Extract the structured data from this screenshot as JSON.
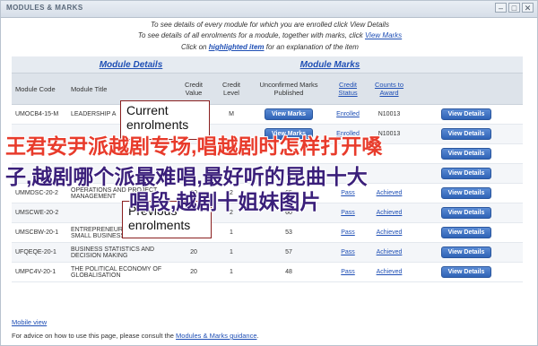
{
  "window": {
    "title": "MODULES & MARKS",
    "controls": [
      "–",
      "□",
      "✕"
    ]
  },
  "instructions": {
    "line1": "To see details of every module for which you are enrolled click View Details",
    "line2_prefix": "To see details of all enrolments for a module, together with marks, click",
    "line2_link": "View Marks",
    "line3_prefix": "Click on",
    "line3_link": "highlighted item",
    "line3_suffix": "for an explanation of the item"
  },
  "groups": {
    "module_details": "Module Details",
    "module_marks": "Module Marks"
  },
  "columns": {
    "module_code": "Module Code",
    "module_title": "Module Title",
    "credit_value": "Credit Value",
    "credit_level": "Credit Level",
    "unconfirmed_marks": "Unconfirmed Marks Published",
    "credit_status": "Credit Status",
    "counts_to_award": "Counts to Award"
  },
  "rows": [
    {
      "code": "UMOCB4-15-M",
      "title": "LEADERSHIP A",
      "value": "15",
      "level": "M",
      "action": "View Marks",
      "status": "Enrolled",
      "award": "N10013",
      "details": "View Details"
    },
    {
      "code": "",
      "title": "",
      "value": "",
      "level": "",
      "action": "View Marks",
      "status": "Enrolled",
      "award": "N10013",
      "details": "View Details"
    },
    {
      "code": "",
      "title": "",
      "value": "",
      "level": "",
      "action": "",
      "status": "",
      "award": "",
      "details": "View Details"
    },
    {
      "code": "",
      "title": "",
      "value": "",
      "level": "",
      "action": "",
      "status": "",
      "award": "",
      "details": "View Details"
    },
    {
      "code": "UMMDSC-20-2",
      "title": "OPERATIONS AND PROJECT MANAGEMENT",
      "value": "20",
      "level": "2",
      "action": "65",
      "status": "Pass",
      "award": "Achieved",
      "details": "View Details"
    },
    {
      "code": "UMSCWE-20-2",
      "title": "",
      "value": "20",
      "level": "2",
      "action": "60",
      "status": "Pass",
      "award": "Achieved",
      "details": "View Details"
    },
    {
      "code": "UMSCBW-20-1",
      "title": "ENTREPRENEURSHIP AND SMALL BUSINESS",
      "value": "20",
      "level": "1",
      "action": "53",
      "status": "Pass",
      "award": "Achieved",
      "details": "View Details"
    },
    {
      "code": "UFQEQE-20-1",
      "title": "BUSINESS STATISTICS AND DECISION MAKING",
      "value": "20",
      "level": "1",
      "action": "57",
      "status": "Pass",
      "award": "Achieved",
      "details": "View Details"
    },
    {
      "code": "UMPC4V-20-1",
      "title": "THE POLITICAL ECONOMY OF GLOBALISATION",
      "value": "20",
      "level": "1",
      "action": "48",
      "status": "Pass",
      "award": "Achieved",
      "details": "View Details"
    }
  ],
  "current_box": [
    "Current",
    "enrolments"
  ],
  "previous_box": [
    "Previous",
    "enrolments"
  ],
  "mobile_view": "Mobile view",
  "footer": {
    "prefix": "For advice on how to use this page, please consult the",
    "link": "Modules & Marks guidance",
    "suffix": "."
  },
  "watermark": {
    "line1": "王君安尹派越剧专场,唱越剧时怎样打开嗓",
    "line2": "子,越剧哪个派最难唱,最好听的昆曲十大",
    "line3": "唱段,越剧十姐妹图片"
  }
}
